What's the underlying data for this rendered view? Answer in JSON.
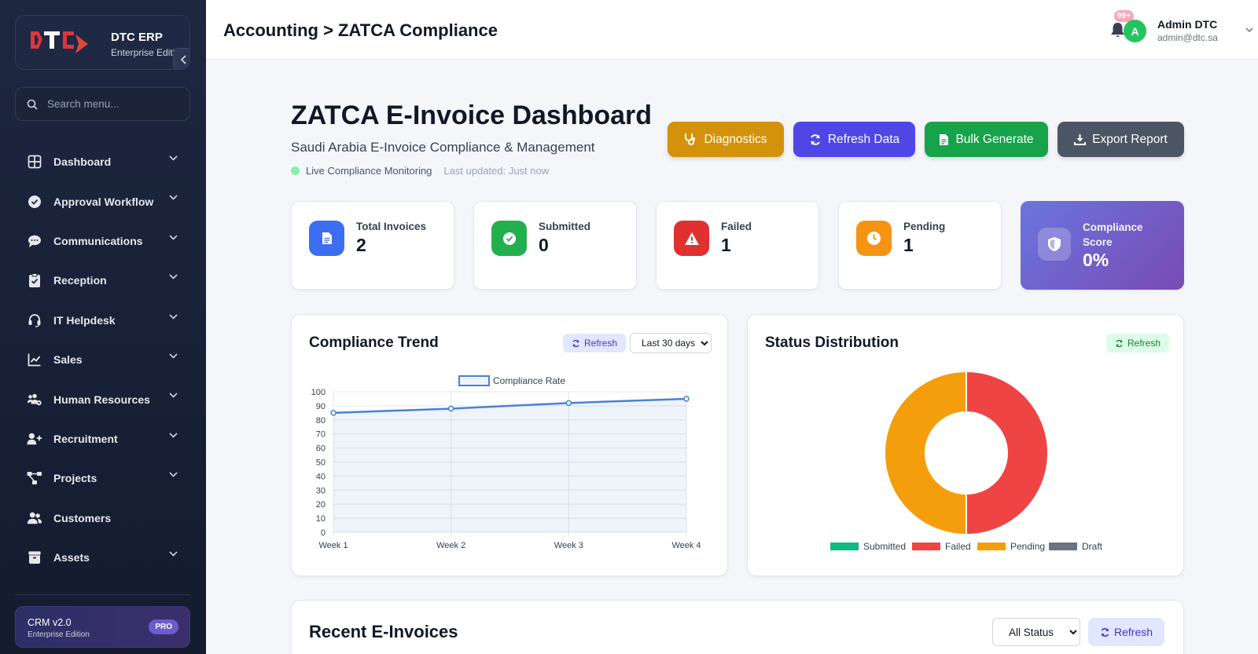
{
  "sidebar": {
    "brand_title": "DTC ERP",
    "brand_subtitle": "Enterprise Edition",
    "logo_text": "DTC",
    "search_placeholder": "Search menu...",
    "items": [
      {
        "label": "Dashboard",
        "icon": "grid-icon",
        "has_chevron": true
      },
      {
        "label": "Approval Workflow",
        "icon": "check-circle-icon",
        "has_chevron": true
      },
      {
        "label": "Communications",
        "icon": "chat-icon",
        "has_chevron": true
      },
      {
        "label": "Reception",
        "icon": "clipboard-check-icon",
        "has_chevron": true
      },
      {
        "label": "IT Helpdesk",
        "icon": "headset-icon",
        "has_chevron": true
      },
      {
        "label": "Sales",
        "icon": "line-chart-icon",
        "has_chevron": true
      },
      {
        "label": "Human Resources",
        "icon": "users-gear-icon",
        "has_chevron": true
      },
      {
        "label": "Recruitment",
        "icon": "user-plus-icon",
        "has_chevron": true
      },
      {
        "label": "Projects",
        "icon": "project-diagram-icon",
        "has_chevron": true
      },
      {
        "label": "Customers",
        "icon": "users-icon",
        "has_chevron": false
      },
      {
        "label": "Assets",
        "icon": "box-icon",
        "has_chevron": true
      }
    ],
    "footer": {
      "version": "CRM v2.0",
      "edition": "Enterprise Edition",
      "badge": "PRO"
    }
  },
  "header": {
    "breadcrumb": "Accounting > ZATCA Compliance",
    "notification_count": "99+",
    "user_initial": "A",
    "user_name": "Admin DTC",
    "user_email": "admin@dtc.sa"
  },
  "page": {
    "title": "ZATCA E-Invoice Dashboard",
    "subtitle": "Saudi Arabia E-Invoice Compliance & Management",
    "live_status": "Live Compliance Monitoring",
    "last_updated": "Last updated: Just now"
  },
  "actions": {
    "diagnostics": "Diagnostics",
    "refresh": "Refresh Data",
    "bulk_generate": "Bulk Generate",
    "export": "Export Report"
  },
  "colors": {
    "diagnostics": "#d4920b",
    "refresh": "#4f46e5",
    "bulk_generate": "#16a34a",
    "export": "#4b5563",
    "submitted": "#10b981",
    "failed": "#ef4444",
    "pending": "#f59e0b",
    "draft": "#6b7280",
    "line": "#4a80d8"
  },
  "stats": {
    "total": {
      "label": "Total Invoices",
      "value": "2"
    },
    "submitted": {
      "label": "Submitted",
      "value": "0"
    },
    "failed": {
      "label": "Failed",
      "value": "1"
    },
    "pending": {
      "label": "Pending",
      "value": "1"
    },
    "score": {
      "label": "Compliance Score",
      "value": "0%"
    }
  },
  "trend_panel": {
    "title": "Compliance Trend",
    "refresh_label": "Refresh",
    "range_selected": "Last 30 days"
  },
  "status_panel": {
    "title": "Status Distribution",
    "refresh_label": "Refresh"
  },
  "recent_panel": {
    "title": "Recent E-Invoices",
    "filter_selected": "All Status",
    "refresh_label": "Refresh"
  },
  "chart_data": [
    {
      "type": "line",
      "title": "",
      "x": [
        "Week 1",
        "Week 2",
        "Week 3",
        "Week 4"
      ],
      "series": [
        {
          "name": "Compliance Rate",
          "values": [
            85,
            88,
            92,
            95
          ]
        }
      ],
      "ylim": [
        0,
        100
      ],
      "yticks": [
        0,
        10,
        20,
        30,
        40,
        50,
        60,
        70,
        80,
        90,
        100
      ],
      "grid": true,
      "legend": "top"
    },
    {
      "type": "pie",
      "title": "",
      "categories": [
        "Submitted",
        "Failed",
        "Pending",
        "Draft"
      ],
      "values": [
        0,
        1,
        1,
        0
      ],
      "donut": true,
      "legend": "bottom"
    }
  ]
}
